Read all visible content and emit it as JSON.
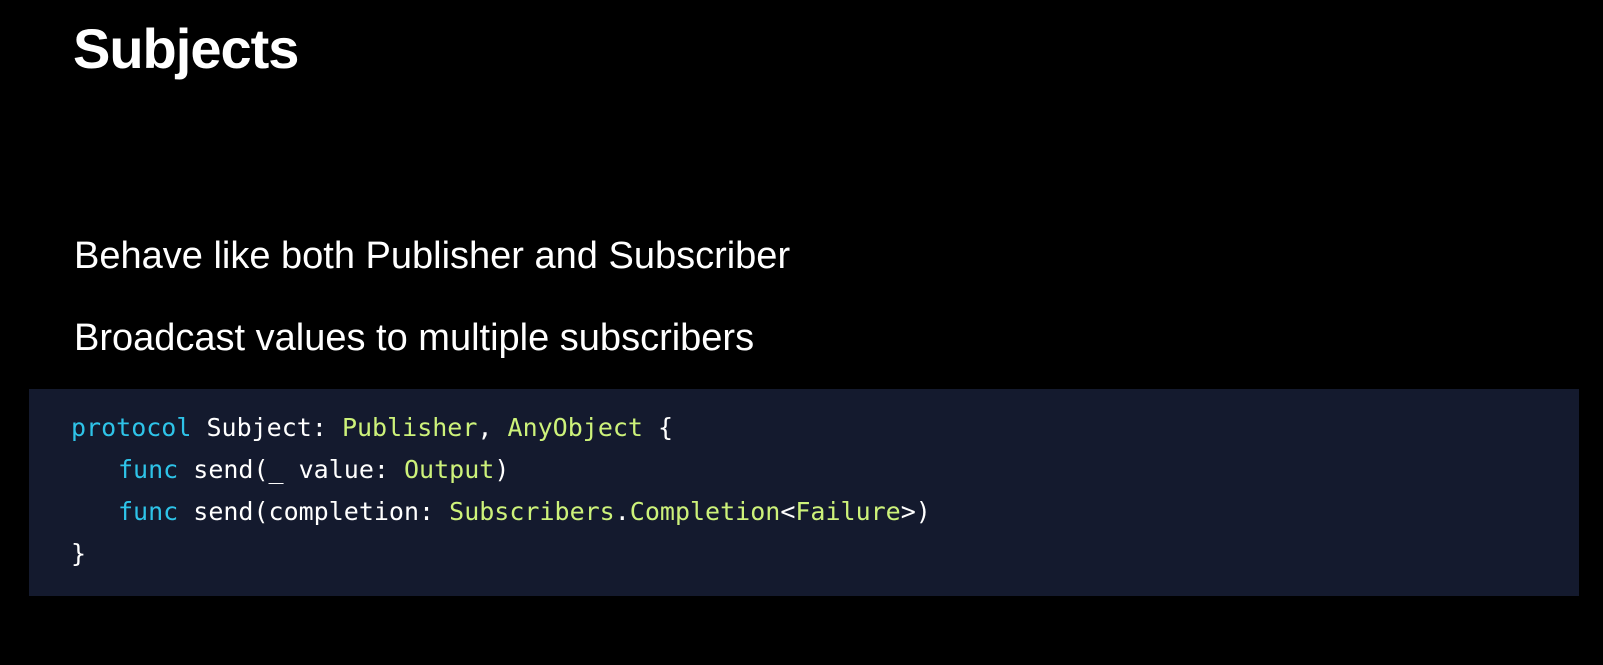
{
  "title": "Subjects",
  "bullets": [
    "Behave like both Publisher and Subscriber",
    "Broadcast values to multiple subscribers"
  ],
  "code": {
    "line1": {
      "kw": "protocol",
      "name": " Subject: ",
      "type1": "Publisher",
      "sep": ", ",
      "type2": "AnyObject",
      "open": " {"
    },
    "line2": {
      "kw": "func",
      "text": " send(_ value: ",
      "type": "Output",
      "close": ")"
    },
    "line3": {
      "kw": "func",
      "text": " send(completion: ",
      "type1": "Subscribers",
      "dot": ".",
      "type2": "Completion",
      "lt": "<",
      "type3": "Failure",
      "close": ">)"
    },
    "line4": {
      "brace": "}"
    }
  },
  "colors": {
    "background": "#000000",
    "code_background": "#141a2e",
    "keyword": "#2ec3e8",
    "type": "#cdf27a",
    "text": "#ffffff"
  }
}
